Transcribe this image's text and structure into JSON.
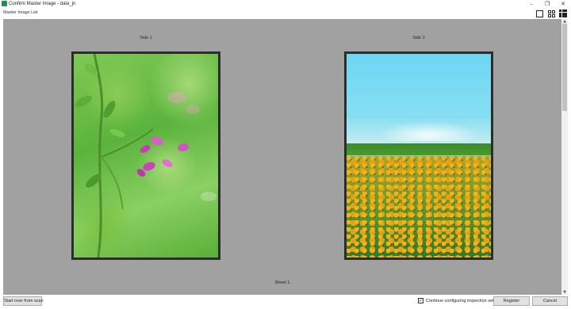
{
  "window": {
    "title": "Confirm Master Image - data_jn",
    "minimize_icon": "–",
    "restore_icon": "❐",
    "close_icon": "✕"
  },
  "subheader": {
    "label": "Master Image List"
  },
  "viewer": {
    "side1_label": "Side 1",
    "side2_label": "Side 2",
    "sheet_label": "Sheet 1"
  },
  "footer": {
    "start_over_label": "Start over from scan",
    "continue_checkbox_label": "Continue configuring inspection settings",
    "continue_checked": true,
    "register_label": "Register",
    "cancel_label": "Cancel"
  },
  "colors": {
    "canvas_bg": "#a1a1a1",
    "accent": "#1e8f4e"
  }
}
